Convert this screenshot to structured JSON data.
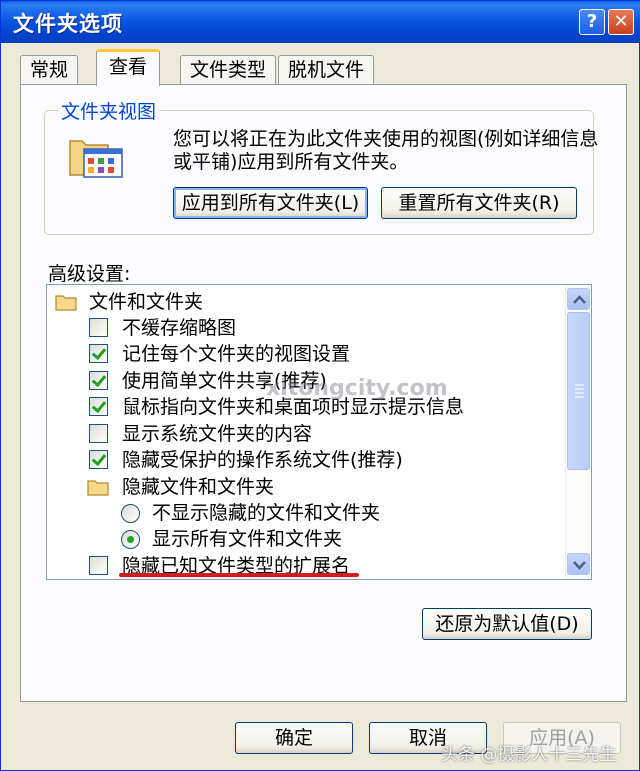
{
  "window": {
    "title": "文件夹选项",
    "help_glyph": "?",
    "close_glyph": "✕"
  },
  "tabs": [
    {
      "label": "常规"
    },
    {
      "label": "查看"
    },
    {
      "label": "文件类型"
    },
    {
      "label": "脱机文件"
    }
  ],
  "active_tab": "查看",
  "folder_view": {
    "legend": "文件夹视图",
    "description": "您可以将正在为此文件夹使用的视图(例如详细信息或平铺)应用到所有文件夹。",
    "apply_all_label": "应用到所有文件夹(L)",
    "reset_all_label": "重置所有文件夹(R)"
  },
  "advanced": {
    "label": "高级设置:",
    "items": [
      {
        "type": "folder",
        "label": "文件和文件夹"
      },
      {
        "type": "checkbox",
        "checked": false,
        "label": "不缓存缩略图"
      },
      {
        "type": "checkbox",
        "checked": true,
        "label": "记住每个文件夹的视图设置"
      },
      {
        "type": "checkbox",
        "checked": true,
        "label": "使用简单文件共享(推荐)"
      },
      {
        "type": "checkbox",
        "checked": true,
        "label": "鼠标指向文件夹和桌面项时显示提示信息"
      },
      {
        "type": "checkbox",
        "checked": false,
        "label": "显示系统文件夹的内容"
      },
      {
        "type": "checkbox",
        "checked": true,
        "label": "隐藏受保护的操作系统文件(推荐)"
      },
      {
        "type": "folder",
        "label": "隐藏文件和文件夹"
      },
      {
        "type": "radio",
        "checked": false,
        "label": "不显示隐藏的文件和文件夹"
      },
      {
        "type": "radio",
        "checked": true,
        "label": "显示所有文件和文件夹"
      },
      {
        "type": "checkbox",
        "checked": false,
        "label": "隐藏已知文件类型的扩展名"
      }
    ],
    "restore_defaults_label": "还原为默认值(D)"
  },
  "footer": {
    "ok_label": "确定",
    "cancel_label": "取消",
    "apply_label": "应用(A)"
  },
  "watermark_text": "xitongcity.com",
  "corner_watermark": "头条 @摄影人十三先生",
  "colors": {
    "title_bar": "#0b58e0",
    "dialog_bg": "#ece9d8",
    "legend_text": "#0046d5",
    "check_green": "#21a121",
    "annotation_red": "#d41c1c",
    "active_tab_accent": "#ffc83c"
  }
}
